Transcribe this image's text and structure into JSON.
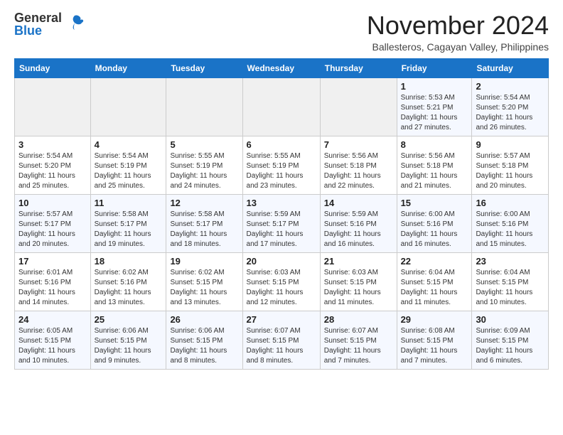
{
  "header": {
    "logo_general": "General",
    "logo_blue": "Blue",
    "month_title": "November 2024",
    "location": "Ballesteros, Cagayan Valley, Philippines"
  },
  "calendar": {
    "headers": [
      "Sunday",
      "Monday",
      "Tuesday",
      "Wednesday",
      "Thursday",
      "Friday",
      "Saturday"
    ],
    "weeks": [
      [
        {
          "day": "",
          "empty": true
        },
        {
          "day": "",
          "empty": true
        },
        {
          "day": "",
          "empty": true
        },
        {
          "day": "",
          "empty": true
        },
        {
          "day": "",
          "empty": true
        },
        {
          "day": "1",
          "sunrise": "Sunrise: 5:53 AM",
          "sunset": "Sunset: 5:21 PM",
          "daylight": "Daylight: 11 hours and 27 minutes."
        },
        {
          "day": "2",
          "sunrise": "Sunrise: 5:54 AM",
          "sunset": "Sunset: 5:20 PM",
          "daylight": "Daylight: 11 hours and 26 minutes."
        }
      ],
      [
        {
          "day": "3",
          "sunrise": "Sunrise: 5:54 AM",
          "sunset": "Sunset: 5:20 PM",
          "daylight": "Daylight: 11 hours and 25 minutes."
        },
        {
          "day": "4",
          "sunrise": "Sunrise: 5:54 AM",
          "sunset": "Sunset: 5:19 PM",
          "daylight": "Daylight: 11 hours and 25 minutes."
        },
        {
          "day": "5",
          "sunrise": "Sunrise: 5:55 AM",
          "sunset": "Sunset: 5:19 PM",
          "daylight": "Daylight: 11 hours and 24 minutes."
        },
        {
          "day": "6",
          "sunrise": "Sunrise: 5:55 AM",
          "sunset": "Sunset: 5:19 PM",
          "daylight": "Daylight: 11 hours and 23 minutes."
        },
        {
          "day": "7",
          "sunrise": "Sunrise: 5:56 AM",
          "sunset": "Sunset: 5:18 PM",
          "daylight": "Daylight: 11 hours and 22 minutes."
        },
        {
          "day": "8",
          "sunrise": "Sunrise: 5:56 AM",
          "sunset": "Sunset: 5:18 PM",
          "daylight": "Daylight: 11 hours and 21 minutes."
        },
        {
          "day": "9",
          "sunrise": "Sunrise: 5:57 AM",
          "sunset": "Sunset: 5:18 PM",
          "daylight": "Daylight: 11 hours and 20 minutes."
        }
      ],
      [
        {
          "day": "10",
          "sunrise": "Sunrise: 5:57 AM",
          "sunset": "Sunset: 5:17 PM",
          "daylight": "Daylight: 11 hours and 20 minutes."
        },
        {
          "day": "11",
          "sunrise": "Sunrise: 5:58 AM",
          "sunset": "Sunset: 5:17 PM",
          "daylight": "Daylight: 11 hours and 19 minutes."
        },
        {
          "day": "12",
          "sunrise": "Sunrise: 5:58 AM",
          "sunset": "Sunset: 5:17 PM",
          "daylight": "Daylight: 11 hours and 18 minutes."
        },
        {
          "day": "13",
          "sunrise": "Sunrise: 5:59 AM",
          "sunset": "Sunset: 5:17 PM",
          "daylight": "Daylight: 11 hours and 17 minutes."
        },
        {
          "day": "14",
          "sunrise": "Sunrise: 5:59 AM",
          "sunset": "Sunset: 5:16 PM",
          "daylight": "Daylight: 11 hours and 16 minutes."
        },
        {
          "day": "15",
          "sunrise": "Sunrise: 6:00 AM",
          "sunset": "Sunset: 5:16 PM",
          "daylight": "Daylight: 11 hours and 16 minutes."
        },
        {
          "day": "16",
          "sunrise": "Sunrise: 6:00 AM",
          "sunset": "Sunset: 5:16 PM",
          "daylight": "Daylight: 11 hours and 15 minutes."
        }
      ],
      [
        {
          "day": "17",
          "sunrise": "Sunrise: 6:01 AM",
          "sunset": "Sunset: 5:16 PM",
          "daylight": "Daylight: 11 hours and 14 minutes."
        },
        {
          "day": "18",
          "sunrise": "Sunrise: 6:02 AM",
          "sunset": "Sunset: 5:16 PM",
          "daylight": "Daylight: 11 hours and 13 minutes."
        },
        {
          "day": "19",
          "sunrise": "Sunrise: 6:02 AM",
          "sunset": "Sunset: 5:15 PM",
          "daylight": "Daylight: 11 hours and 13 minutes."
        },
        {
          "day": "20",
          "sunrise": "Sunrise: 6:03 AM",
          "sunset": "Sunset: 5:15 PM",
          "daylight": "Daylight: 11 hours and 12 minutes."
        },
        {
          "day": "21",
          "sunrise": "Sunrise: 6:03 AM",
          "sunset": "Sunset: 5:15 PM",
          "daylight": "Daylight: 11 hours and 11 minutes."
        },
        {
          "day": "22",
          "sunrise": "Sunrise: 6:04 AM",
          "sunset": "Sunset: 5:15 PM",
          "daylight": "Daylight: 11 hours and 11 minutes."
        },
        {
          "day": "23",
          "sunrise": "Sunrise: 6:04 AM",
          "sunset": "Sunset: 5:15 PM",
          "daylight": "Daylight: 11 hours and 10 minutes."
        }
      ],
      [
        {
          "day": "24",
          "sunrise": "Sunrise: 6:05 AM",
          "sunset": "Sunset: 5:15 PM",
          "daylight": "Daylight: 11 hours and 10 minutes."
        },
        {
          "day": "25",
          "sunrise": "Sunrise: 6:06 AM",
          "sunset": "Sunset: 5:15 PM",
          "daylight": "Daylight: 11 hours and 9 minutes."
        },
        {
          "day": "26",
          "sunrise": "Sunrise: 6:06 AM",
          "sunset": "Sunset: 5:15 PM",
          "daylight": "Daylight: 11 hours and 8 minutes."
        },
        {
          "day": "27",
          "sunrise": "Sunrise: 6:07 AM",
          "sunset": "Sunset: 5:15 PM",
          "daylight": "Daylight: 11 hours and 8 minutes."
        },
        {
          "day": "28",
          "sunrise": "Sunrise: 6:07 AM",
          "sunset": "Sunset: 5:15 PM",
          "daylight": "Daylight: 11 hours and 7 minutes."
        },
        {
          "day": "29",
          "sunrise": "Sunrise: 6:08 AM",
          "sunset": "Sunset: 5:15 PM",
          "daylight": "Daylight: 11 hours and 7 minutes."
        },
        {
          "day": "30",
          "sunrise": "Sunrise: 6:09 AM",
          "sunset": "Sunset: 5:15 PM",
          "daylight": "Daylight: 11 hours and 6 minutes."
        }
      ]
    ]
  }
}
